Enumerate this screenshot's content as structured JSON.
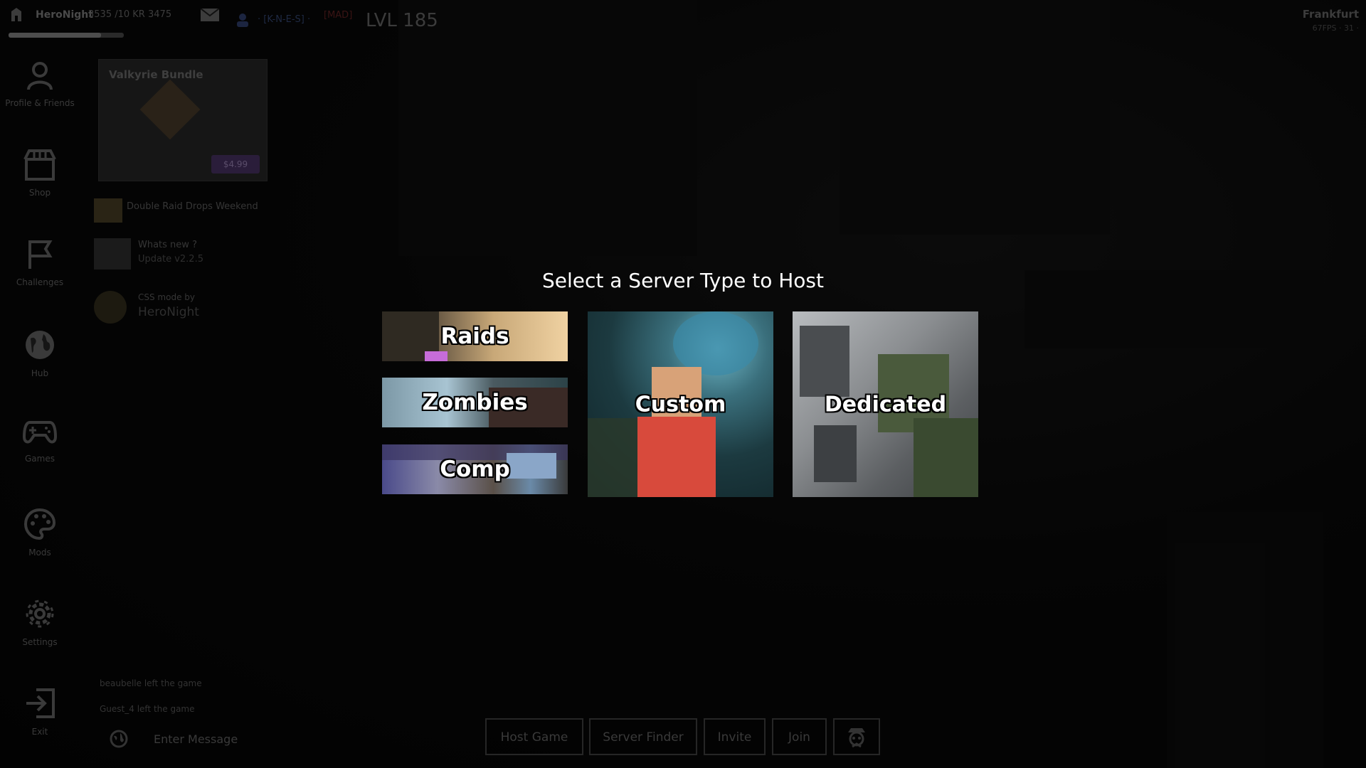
{
  "topbar": {
    "username": "HeroNight",
    "kr_balance": "3535 /10 KR",
    "kr_extra": "3475",
    "clan_text": "· [K-N-E-S] ·",
    "clan_tag": "[MAD]",
    "level": "LVL 185",
    "region": "Frankfurt",
    "fps": "67FPS · 31 ·",
    "xp_progress": 0.8
  },
  "sidebar": {
    "items": [
      {
        "label": "Profile & Friends",
        "icon": "profile-icon"
      },
      {
        "label": "Shop",
        "icon": "shop-icon"
      },
      {
        "label": "Challenges",
        "icon": "flag-icon"
      },
      {
        "label": "Hub",
        "icon": "globe-icon"
      },
      {
        "label": "Games",
        "icon": "gamepad-icon"
      },
      {
        "label": "Mods",
        "icon": "palette-icon"
      },
      {
        "label": "Settings",
        "icon": "gear-icon"
      },
      {
        "label": "Exit",
        "icon": "exit-icon"
      }
    ]
  },
  "news": {
    "bundle_title": "Valkyrie Bundle",
    "bundle_price": "$4.99",
    "rows": [
      {
        "title": "Double Raid Drops Weekend",
        "subtitle": ""
      },
      {
        "title": "Whats new ?",
        "subtitle": "Update v2.2.5"
      },
      {
        "title": "CSS mode by",
        "subtitle": "HeroNight"
      }
    ]
  },
  "chat": {
    "messages": [
      "beaubelle left the game",
      "Guest_4 left the game"
    ],
    "placeholder": "Enter Message"
  },
  "bottom_bar": {
    "host_game": "Host Game",
    "server_finder": "Server Finder",
    "invite": "Invite",
    "join": "Join"
  },
  "modal": {
    "title": "Select a Server Type to Host",
    "options": {
      "raids": "Raids",
      "zombies": "Zombies",
      "comp": "Comp",
      "custom": "Custom",
      "dedicated": "Dedicated"
    }
  }
}
